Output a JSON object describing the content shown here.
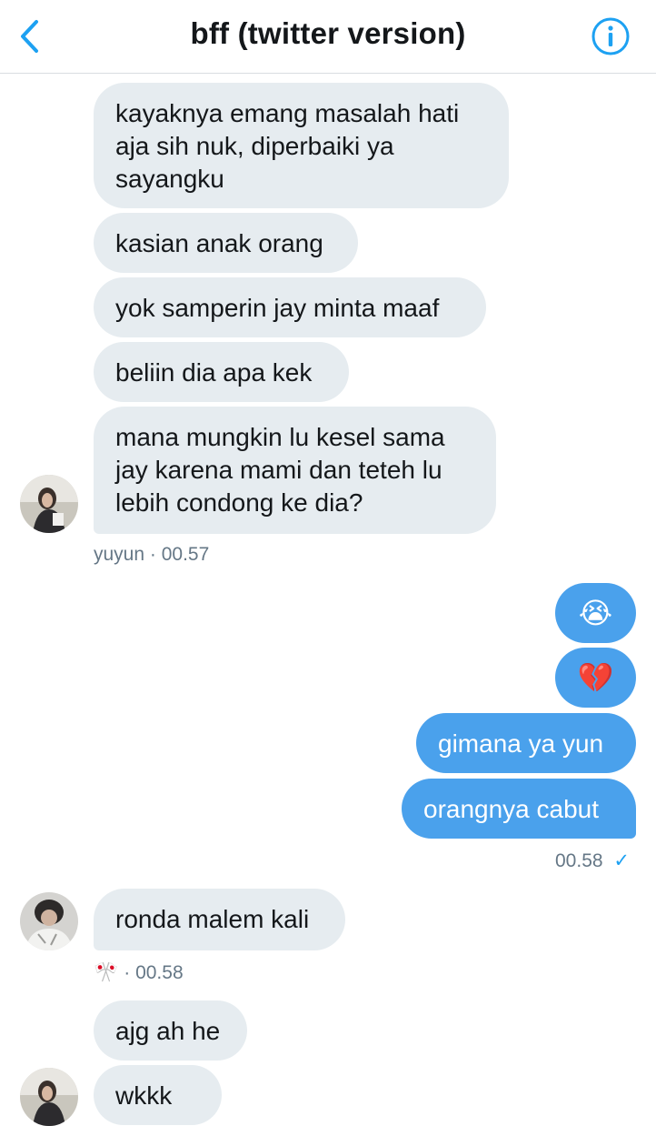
{
  "header": {
    "title": "bff (twitter version)"
  },
  "messages_in_1": [
    "kayaknya emang masalah hati aja sih nuk, diperbaiki ya sayangku",
    "kasian anak orang",
    "yok samperin jay minta maaf",
    "beliin dia apa kek",
    "mana mungkin lu kesel sama jay karena mami dan teteh lu lebih condong ke dia?"
  ],
  "meta_in_1": {
    "name": "yuyun",
    "time": "00.57"
  },
  "messages_out": [
    "😭",
    "💔",
    "gimana ya yun",
    "orangnya cabut"
  ],
  "meta_out": {
    "time": "00.58",
    "status": "✓"
  },
  "messages_in_2": [
    "ronda malem kali"
  ],
  "meta_in_2": {
    "name": "🎌",
    "time": "00.58"
  },
  "messages_in_3": [
    "ajg ah he",
    "wkkk"
  ],
  "colors": {
    "accent": "#1da1f2",
    "outgoing": "#4aa1ec",
    "incoming": "#e6ecf0"
  }
}
